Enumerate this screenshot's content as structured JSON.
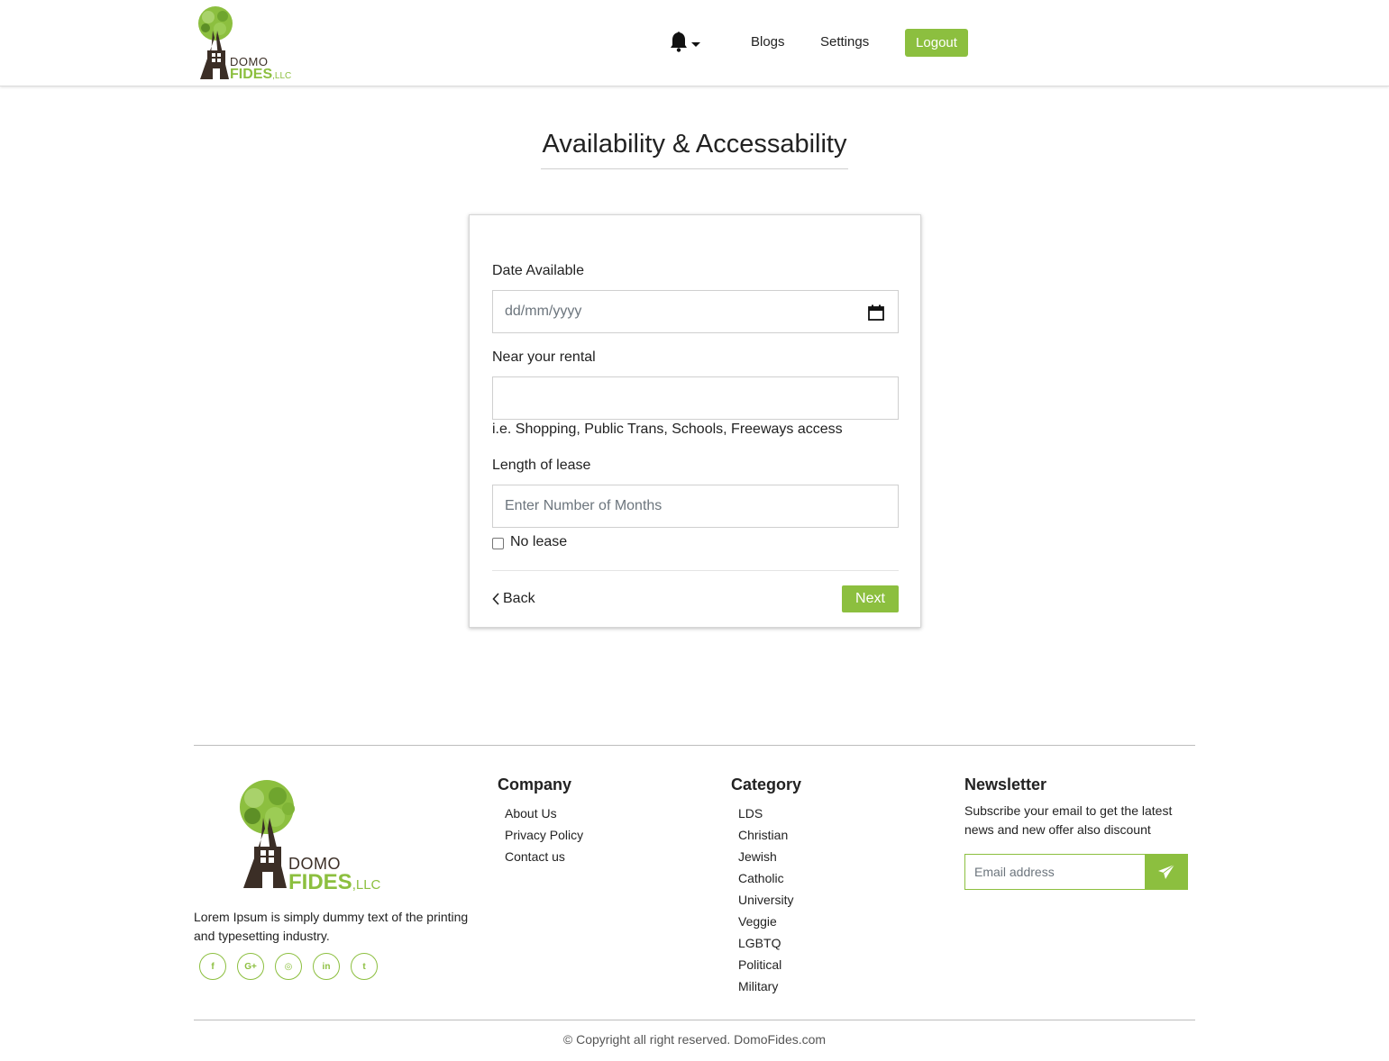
{
  "header": {
    "logo": {
      "top": "DOMO",
      "main": "FIDES",
      "suffix": ",LLC"
    },
    "nav": {
      "blogs": "Blogs",
      "settings": "Settings",
      "logout": "Logout"
    },
    "bell_icon": "bell-icon"
  },
  "page": {
    "title": "Availability & Accessability"
  },
  "form": {
    "date_label": "Date Available",
    "date_placeholder": "dd/mm/yyyy",
    "near_label": "Near your rental",
    "near_value": "",
    "near_helper": "i.e. Shopping, Public Trans, Schools, Freeways access",
    "lease_label": "Length of lease",
    "lease_placeholder": "Enter Number of Months",
    "no_lease_label": "No lease",
    "no_lease_checked": false,
    "back_label": "Back",
    "next_label": "Next"
  },
  "footer": {
    "logo": {
      "top": "DOMO",
      "main": "FIDES",
      "suffix": ",LLC"
    },
    "about": "Lorem Ipsum is simply dummy text of the printing and typesetting industry.",
    "socials": [
      {
        "icon": "facebook-icon",
        "glyph": "f"
      },
      {
        "icon": "google-plus-icon",
        "glyph": "G+"
      },
      {
        "icon": "instagram-icon",
        "glyph": "◎"
      },
      {
        "icon": "linkedin-icon",
        "glyph": "in"
      },
      {
        "icon": "twitter-icon",
        "glyph": "t"
      }
    ],
    "company": {
      "title": "Company",
      "links": [
        "About Us",
        "Privacy Policy",
        "Contact us"
      ]
    },
    "category": {
      "title": "Category",
      "links": [
        "LDS",
        "Christian",
        "Jewish",
        "Catholic",
        "University",
        "Veggie",
        "LGBTQ",
        "Political",
        "Military"
      ]
    },
    "newsletter": {
      "title": "Newsletter",
      "text": "Subscribe your email to get the latest news and new offer also discount",
      "placeholder": "Email address"
    },
    "copyright": "© Copyright all right reserved. DomoFides.com"
  },
  "colors": {
    "accent": "#8cbf3f",
    "logo_brown": "#3b2e26"
  }
}
